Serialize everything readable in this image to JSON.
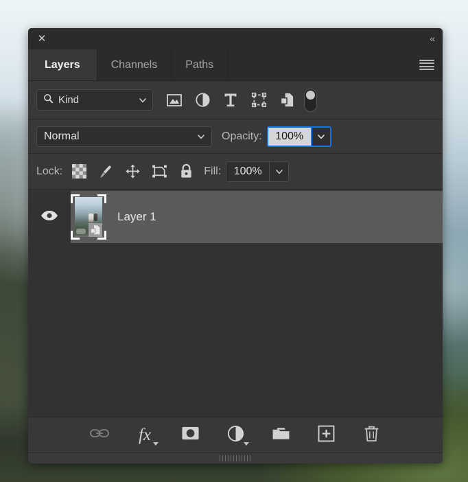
{
  "panel": {
    "title_bar": {
      "close_label": "✕",
      "collapse_label": "«"
    },
    "tabs": [
      {
        "label": "Layers",
        "active": true
      },
      {
        "label": "Channels",
        "active": false
      },
      {
        "label": "Paths",
        "active": false
      }
    ],
    "menu_icon": "hamburger-menu-icon"
  },
  "filter_row": {
    "kind_select": {
      "value": "Kind",
      "search_icon": "search-icon",
      "chevron_icon": "chevron-down-icon"
    },
    "filter_icons": [
      {
        "name": "pixel-layer-filter-icon"
      },
      {
        "name": "adjustment-layer-filter-icon"
      },
      {
        "name": "type-layer-filter-icon"
      },
      {
        "name": "shape-layer-filter-icon"
      },
      {
        "name": "smart-object-filter-icon"
      }
    ],
    "toggle": {
      "name": "filter-enable-toggle",
      "state": "off"
    }
  },
  "blend_row": {
    "blend_mode": "Normal",
    "opacity_label": "Opacity:",
    "opacity_value": "100%"
  },
  "lock_row": {
    "lock_label": "Lock:",
    "lock_icons": [
      {
        "name": "lock-transparent-pixels-icon"
      },
      {
        "name": "lock-image-pixels-icon"
      },
      {
        "name": "lock-position-icon"
      },
      {
        "name": "lock-artboard-nesting-icon"
      },
      {
        "name": "lock-all-icon"
      }
    ],
    "fill_label": "Fill:",
    "fill_value": "100%"
  },
  "layers": [
    {
      "name": "Layer 1",
      "visible": true,
      "selected": true,
      "thumbnail": "mountain-landscape-thumbnail",
      "badge": "smart-object-badge"
    }
  ],
  "footer_buttons": [
    {
      "name": "link-layers-button",
      "icon": "link-icon"
    },
    {
      "name": "layer-style-button",
      "icon": "fx-icon",
      "label": "fx",
      "has_menu": true
    },
    {
      "name": "add-layer-mask-button",
      "icon": "layer-mask-icon"
    },
    {
      "name": "new-adjustment-layer-button",
      "icon": "adjustment-layer-icon",
      "has_menu": true
    },
    {
      "name": "new-group-button",
      "icon": "folder-icon"
    },
    {
      "name": "new-layer-button",
      "icon": "plus-square-icon"
    },
    {
      "name": "delete-layer-button",
      "icon": "trash-icon"
    }
  ],
  "colors": {
    "panel_bg": "#323232",
    "row_bg": "#383838",
    "titlebar_bg": "#2b2b2b",
    "selected_layer_bg": "#5a5a5a",
    "focus_accent": "#1473e6",
    "text_primary": "#e6e6e6",
    "text_muted": "#a6a6a6"
  }
}
